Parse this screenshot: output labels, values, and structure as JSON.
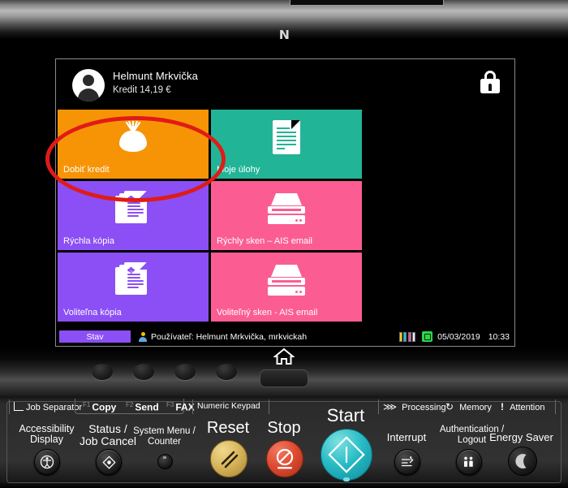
{
  "device": {
    "nfc_label": "N",
    "nfc_icon": "nfc-n-logo"
  },
  "screen": {
    "user": {
      "name": "Helmunt Mrkvička",
      "credit": "Kredit 14,19 €",
      "avatar_icon": "user-avatar-icon"
    },
    "lock_icon": "lock-icon",
    "tiles": [
      {
        "label": "Dobiť kredit",
        "color": "#f79406",
        "icon": "money-bag-icon",
        "text_color": "#ffffff"
      },
      {
        "label": "Moje úlohy",
        "color": "#22b496",
        "icon": "document-icon",
        "text_color": "#ffffff"
      },
      {
        "label": "Rýchla kópia",
        "color": "#8b4ff5",
        "icon": "copy-docs-icon",
        "text_color": "#ffffff"
      },
      {
        "label": "Rýchly sken – AIS email",
        "color": "#fb5d92",
        "icon": "scanner-icon",
        "text_color": "#ffffff"
      },
      {
        "label": "Voliteľna kópia",
        "color": "#8b4ff5",
        "icon": "copy-docs-icon",
        "text_color": "#ffffff"
      },
      {
        "label": "Voliteľný sken - AIS email",
        "color": "#fb5d92",
        "icon": "scanner-icon",
        "text_color": "#ffffff"
      }
    ],
    "status_bar": {
      "status_label": "Stav",
      "status_label_color": "#8b4ff5",
      "user_icon": "user-small-icon",
      "user_text": "Používateľ: Helmunt Mrkvička, mrkvickah",
      "toner_icon": "toner-level-icon",
      "toner_colors": [
        "#e8d21c",
        "#1fbfd8",
        "#ef4fb0",
        "#e8e8e8"
      ],
      "clock_icon": "date-time-icon",
      "date": "05/03/2019",
      "time": "10:33"
    }
  },
  "annotation": {
    "shape": "red-ellipse-highlight",
    "color": "#e01b17",
    "targets_tile": "Dobiť kredit"
  },
  "home_row": {
    "home_icon": "home-icon",
    "home_button_label": "",
    "soft_keys": [
      "soft-key-1",
      "soft-key-2",
      "soft-key-3",
      "soft-key-4"
    ]
  },
  "key_panel": {
    "top_labels": [
      {
        "name": "job-separator",
        "label": "Job Separator",
        "icon": "job-separator-icon",
        "fkey": ""
      },
      {
        "name": "copy",
        "label": "Copy",
        "icon": "",
        "fkey": "F1"
      },
      {
        "name": "send",
        "label": "Send",
        "icon": "",
        "fkey": "F2"
      },
      {
        "name": "fax",
        "label": "FAX",
        "icon": "",
        "fkey": "F3"
      },
      {
        "name": "numeric-keypad",
        "label": "Numeric Keypad",
        "icon": "",
        "fkey": ""
      }
    ],
    "indicators": [
      {
        "name": "processing",
        "label": "Processing",
        "glyph": "⋙"
      },
      {
        "name": "memory",
        "label": "Memory",
        "glyph": "↻"
      },
      {
        "name": "attention",
        "label": "Attention",
        "glyph": "!"
      }
    ],
    "buttons": [
      {
        "name": "accessibility-display",
        "label": "Accessibility\nDisplay",
        "line1": "Accessibility",
        "line2": "Display",
        "icon": "accessibility-icon"
      },
      {
        "name": "status-job-cancel",
        "label": "Status /\nJob Cancel",
        "line1": "Status /",
        "line2": "Job Cancel",
        "icon": "status-icon"
      },
      {
        "name": "system-menu-counter",
        "label": "System Menu /\nCounter",
        "line1": "System Menu /",
        "line2": "Counter",
        "icon": "system-menu-icon"
      },
      {
        "name": "reset",
        "label": "Reset",
        "line1": "Reset",
        "line2": "",
        "icon": "reset-icon"
      },
      {
        "name": "stop",
        "label": "Stop",
        "line1": "Stop",
        "line2": "",
        "icon": "stop-icon"
      },
      {
        "name": "start",
        "label": "Start",
        "line1": "Start",
        "line2": "",
        "icon": "start-icon"
      },
      {
        "name": "interrupt",
        "label": "Interrupt",
        "line1": "Interrupt",
        "line2": "",
        "icon": "interrupt-icon"
      },
      {
        "name": "authentication-logout",
        "label": "Authentication /\nLogout",
        "line1": "Authentication /",
        "line2": "Logout",
        "icon": "authentication-icon"
      },
      {
        "name": "energy-saver",
        "label": "Energy Saver",
        "line1": "Energy Saver",
        "line2": "",
        "icon": "moon-icon"
      }
    ]
  }
}
